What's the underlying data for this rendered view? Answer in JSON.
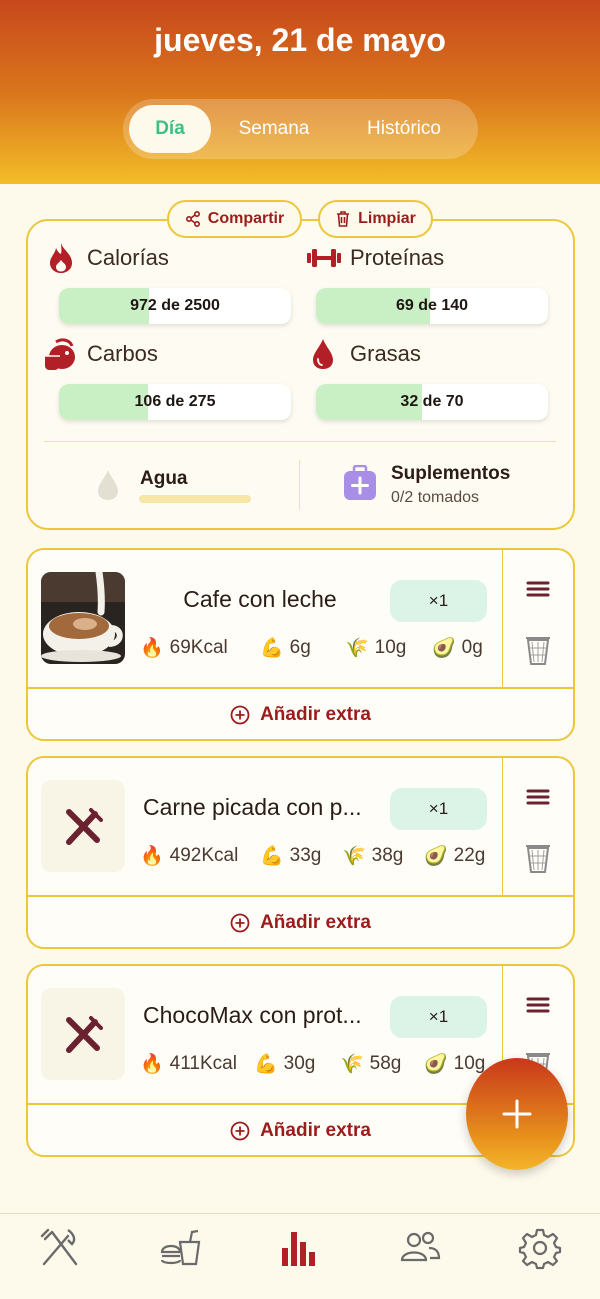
{
  "header": {
    "date": "jueves, 21 de mayo",
    "tabs": [
      {
        "label": "Día",
        "active": true
      },
      {
        "label": "Semana",
        "active": false
      },
      {
        "label": "Histórico",
        "active": false
      }
    ]
  },
  "summary": {
    "share_label": "Compartir",
    "clear_label": "Limpiar",
    "macros": {
      "calories": {
        "label": "Calorías",
        "text": "972 de 2500",
        "value": 972,
        "goal": 2500
      },
      "protein": {
        "label": "Proteínas",
        "text": "69 de 140",
        "value": 69,
        "goal": 140
      },
      "carbs": {
        "label": "Carbos",
        "text": "106 de 275",
        "value": 106,
        "goal": 275
      },
      "fats": {
        "label": "Grasas",
        "text": "32 de 70",
        "value": 32,
        "goal": 70
      }
    },
    "water": {
      "label": "Agua",
      "progress": 0
    },
    "supplements": {
      "label": "Suplementos",
      "status": "0/2 tomados"
    }
  },
  "meals": [
    {
      "name": "Cafe con leche",
      "qty": "×1",
      "kcal": "69Kcal",
      "protein": "6g",
      "carbs": "10g",
      "fat": "0g",
      "has_photo": true,
      "extra_label": "Añadir extra"
    },
    {
      "name": "Carne picada con p...",
      "qty": "×1",
      "kcal": "492Kcal",
      "protein": "33g",
      "carbs": "38g",
      "fat": "22g",
      "has_photo": false,
      "extra_label": "Añadir extra"
    },
    {
      "name": "ChocoMax con prot...",
      "qty": "×1",
      "kcal": "411Kcal",
      "protein": "30g",
      "carbs": "58g",
      "fat": "10g",
      "has_photo": false,
      "extra_label": "Añadir extra"
    }
  ],
  "fab_icon": "plus-icon",
  "nav": [
    "utensils-icon",
    "fast-food-icon",
    "bar-chart-icon",
    "people-icon",
    "settings-icon"
  ],
  "colors": {
    "accent_red": "#9c1c1c",
    "accent_green": "#3fbf83",
    "border_yellow": "#ecc73a"
  }
}
